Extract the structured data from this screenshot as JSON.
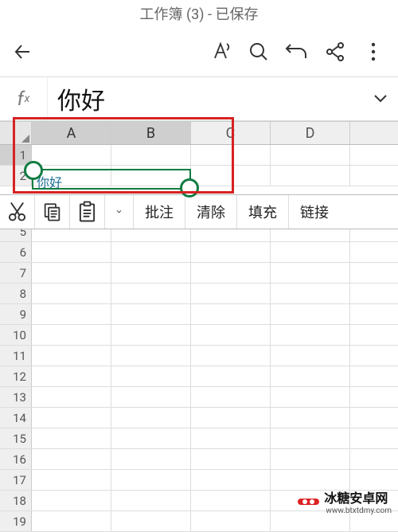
{
  "title": "工作簿 (3) - 已保存",
  "formula_bar": {
    "value": "你好"
  },
  "columns": [
    "A",
    "B",
    "C",
    "D"
  ],
  "selected_columns": [
    "A",
    "B"
  ],
  "selected_rows": [
    1
  ],
  "cells": {
    "A1": "你好"
  },
  "context_menu": {
    "annotate": "批注",
    "clear": "清除",
    "fill": "填充",
    "link": "链接"
  },
  "visible_row_start": 1,
  "visible_row_end": 19,
  "watermark": {
    "brand": "冰糖安卓网",
    "url": "www.btxtdmy.com"
  },
  "icons": {
    "back": "back-arrow",
    "font": "font-style",
    "search": "search",
    "undo": "undo",
    "share": "share",
    "more": "more-vertical",
    "cut": "scissors",
    "copy": "copy",
    "paste": "paste",
    "chevron_down": "chevron-down"
  }
}
